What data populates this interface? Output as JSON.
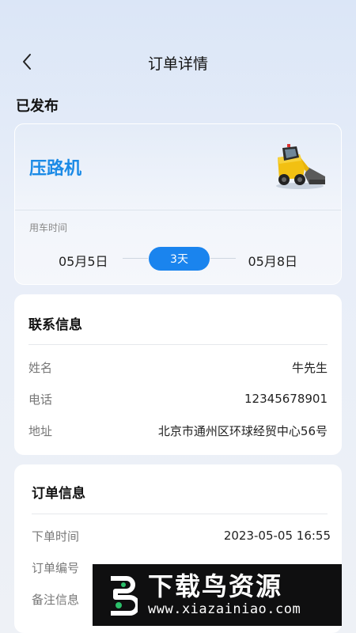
{
  "header": {
    "title": "订单详情"
  },
  "status": "已发布",
  "vehicle": {
    "name": "压路机",
    "time_label": "用车时间",
    "start_date": "05月5日",
    "end_date": "05月8日",
    "duration": "3天"
  },
  "contact": {
    "title": "联系信息",
    "rows": [
      {
        "label": "姓名",
        "value": "牛先生"
      },
      {
        "label": "电话",
        "value": "12345678901"
      },
      {
        "label": "地址",
        "value": "北京市通州区环球经贸中心56号"
      }
    ]
  },
  "order": {
    "title": "订单信息",
    "rows": [
      {
        "label": "下单时间",
        "value": "2023-05-05 16:55"
      },
      {
        "label": "订单编号",
        "value": ""
      },
      {
        "label": "备注信息",
        "value": ""
      }
    ]
  },
  "watermark": {
    "title": "下载鸟资源",
    "url": "www.xiazainiao.com"
  },
  "colors": {
    "accent": "#1a84ee",
    "vehicle_name": "#1a8ae6"
  },
  "icons": {
    "back": "chevron-left-icon",
    "vehicle": "skid-steer-loader-image"
  }
}
